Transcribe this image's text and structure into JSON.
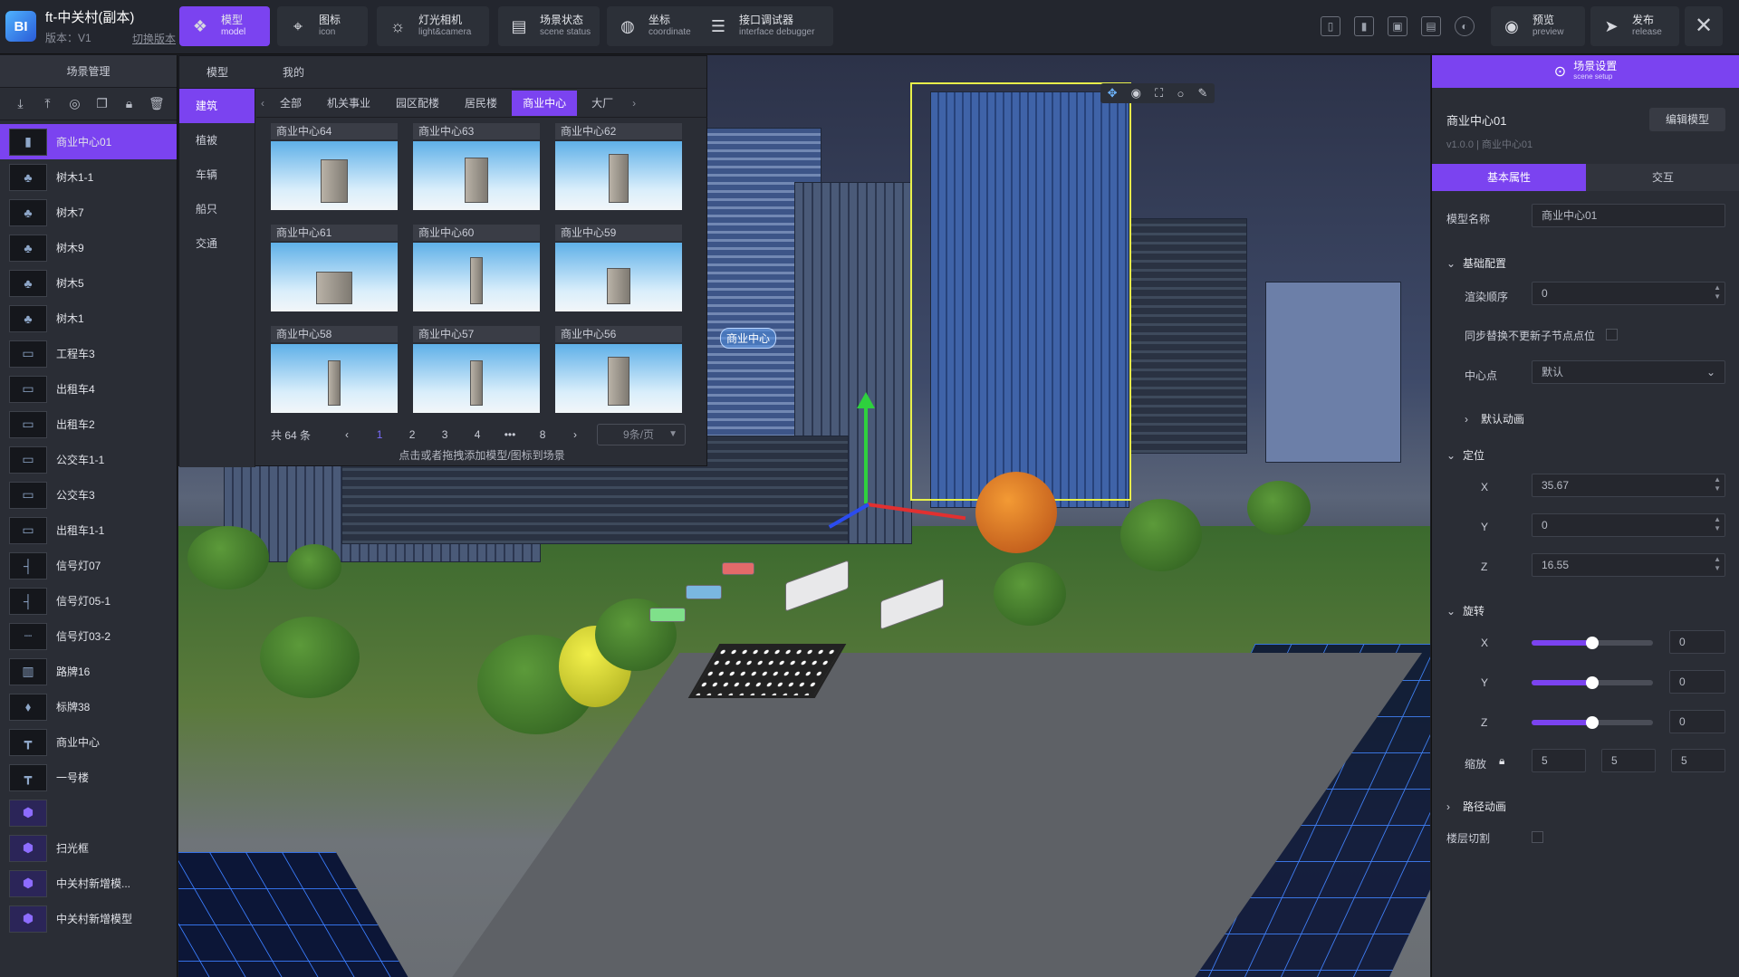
{
  "app": {
    "logo": "BI",
    "title": "ft-中关村(副本)",
    "version": "版本：V1",
    "switch_version": "切换版本"
  },
  "toolbar": {
    "buttons": [
      {
        "zh": "模型",
        "en": "model",
        "icon": "cube-icon",
        "active": true
      },
      {
        "zh": "图标",
        "en": "icon",
        "icon": "pin-icon",
        "active": false
      },
      {
        "zh": "灯光相机",
        "en": "light&camera",
        "icon": "bulb-icon",
        "active": false
      },
      {
        "zh": "场景状态",
        "en": "scene status",
        "icon": "panel-icon",
        "active": false
      },
      {
        "zh": "坐标",
        "en": "coordinate",
        "icon": "globe-icon",
        "active": false
      },
      {
        "zh": "接口调试器",
        "en": "interface debugger",
        "icon": "sliders-icon",
        "active": false
      },
      {
        "zh": "预览",
        "en": "preview",
        "icon": "eye-icon",
        "active": false
      },
      {
        "zh": "发布",
        "en": "release",
        "icon": "send-icon",
        "active": false
      }
    ],
    "close": "✕"
  },
  "left_panel": {
    "title": "场景管理",
    "items": [
      {
        "name": "商业中心01",
        "thumb": "▮",
        "purple": false
      },
      {
        "name": "树木1-1",
        "thumb": "♣",
        "purple": false
      },
      {
        "name": "树木7",
        "thumb": "♣",
        "purple": false
      },
      {
        "name": "树木9",
        "thumb": "♣",
        "purple": false
      },
      {
        "name": "树木5",
        "thumb": "♣",
        "purple": false
      },
      {
        "name": "树木1",
        "thumb": "♣",
        "purple": false
      },
      {
        "name": "工程车3",
        "thumb": "▭",
        "purple": false
      },
      {
        "name": "出租车4",
        "thumb": "▭",
        "purple": false
      },
      {
        "name": "出租车2",
        "thumb": "▭",
        "purple": false
      },
      {
        "name": "公交车1-1",
        "thumb": "▭",
        "purple": false
      },
      {
        "name": "公交车3",
        "thumb": "▭",
        "purple": false
      },
      {
        "name": "出租车1-1",
        "thumb": "▭",
        "purple": false
      },
      {
        "name": "信号灯07",
        "thumb": "┤",
        "purple": false
      },
      {
        "name": "信号灯05-1",
        "thumb": "┤",
        "purple": false
      },
      {
        "name": "信号灯03-2",
        "thumb": "┈",
        "purple": false
      },
      {
        "name": "路牌16",
        "thumb": "▥",
        "purple": false
      },
      {
        "name": "标牌38",
        "thumb": "⬧",
        "purple": false
      },
      {
        "name": "商业中心",
        "thumb": "┳",
        "purple": false
      },
      {
        "name": "一号楼",
        "thumb": "┳",
        "purple": false
      },
      {
        "name": "",
        "thumb": "⬢",
        "purple": true
      },
      {
        "name": "扫光框",
        "thumb": "⬢",
        "purple": true
      },
      {
        "name": "中关村新增模...",
        "thumb": "⬢",
        "purple": true
      },
      {
        "name": "中关村新增模型",
        "thumb": "⬢",
        "purple": true
      }
    ]
  },
  "library": {
    "tabs": [
      "模型",
      "我的"
    ],
    "categories": [
      {
        "label": "建筑",
        "active": true
      },
      {
        "label": "植被",
        "active": false
      },
      {
        "label": "车辆",
        "active": false
      },
      {
        "label": "船只",
        "active": false
      },
      {
        "label": "交通",
        "active": false
      }
    ],
    "subtabs": [
      {
        "label": "全部",
        "active": false
      },
      {
        "label": "机关事业",
        "active": false
      },
      {
        "label": "园区配楼",
        "active": false
      },
      {
        "label": "居民楼",
        "active": false
      },
      {
        "label": "商业中心",
        "active": true
      },
      {
        "label": "大厂",
        "active": false
      }
    ],
    "cards": [
      "商业中心64",
      "商业中心63",
      "商业中心62",
      "商业中心61",
      "商业中心60",
      "商业中心59",
      "商业中心58",
      "商业中心57",
      "商业中心56"
    ],
    "pager": {
      "total": "共 64 条",
      "pages": [
        "1",
        "2",
        "3",
        "4",
        "•••",
        "8"
      ],
      "active_page": "1",
      "per_page": "9条/页"
    },
    "hint": "点击或者拖拽添加模型/图标到场景"
  },
  "viewport": {
    "building_label": "商业中心"
  },
  "right_panel": {
    "header": {
      "zh": "场景设置",
      "en": "scene setup"
    },
    "model_name": "商业中心01",
    "model_sub": "v1.0.0 | 商业中心01",
    "edit_button": "编辑模型",
    "tabs": [
      {
        "label": "基本属性",
        "active": true
      },
      {
        "label": "交互",
        "active": false
      }
    ],
    "name_label": "模型名称",
    "name_value": "商业中心01",
    "basic_section": "基础配置",
    "render_order_label": "渲染顺序",
    "render_order_value": "0",
    "sync_label": "同步替换不更新子节点点位",
    "center_label": "中心点",
    "center_value": "默认",
    "default_anim": "默认动画",
    "position_section": "定位",
    "position": {
      "x_label": "X",
      "x": "35.67",
      "y_label": "Y",
      "y": "0",
      "z_label": "Z",
      "z": "16.55"
    },
    "rotation_section": "旋转",
    "rotation": {
      "x_label": "X",
      "x": "0",
      "x_level": 0.5,
      "y_label": "Y",
      "y": "0",
      "y_level": 0.5,
      "z_label": "Z",
      "z": "0",
      "z_level": 0.5
    },
    "scale_label": "缩放",
    "scale": [
      "5",
      "5",
      "5"
    ],
    "path_anim": "路径动画",
    "floor_cut": "楼层切割"
  }
}
